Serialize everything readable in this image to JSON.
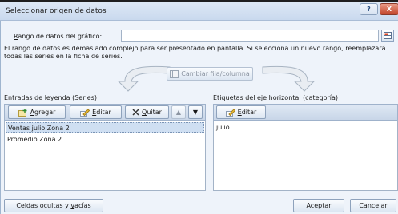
{
  "window": {
    "title": "Seleccionar origen de datos",
    "help_glyph": "?",
    "close_glyph": "X"
  },
  "range": {
    "label_accel": "R",
    "label_rest": "ango de datos del gráfico:",
    "value": ""
  },
  "message": {
    "line1": "El rango de datos es demasiado complejo para ser presentado en pantalla. Si selecciona un nuevo rango, reemplazará",
    "line2": "todas las series en la ficha de series."
  },
  "switch_button": {
    "label_accel": "C",
    "label_rest": "ambiar fila/columna"
  },
  "series_panel": {
    "heading_pre": "Entradas de ley",
    "heading_accel": "e",
    "heading_post": "nda (Series)",
    "add_accel": "A",
    "add_rest": "gregar",
    "edit_accel": "E",
    "edit_rest": "ditar",
    "remove_accel": "Q",
    "remove_rest": "uitar",
    "up_glyph": "▲",
    "down_glyph": "▼",
    "items": [
      "Ventas julio Zona 2",
      "Promedio Zona 2"
    ]
  },
  "category_panel": {
    "heading_pre": "Etiquetas del eje ",
    "heading_accel": "h",
    "heading_post": "orizontal (categoría)",
    "edit_accel": "E",
    "edit_rest": "ditar",
    "items": [
      "julio"
    ]
  },
  "footer": {
    "hidden_cells_pre": "Celdas ocultas y ",
    "hidden_cells_accel": "v",
    "hidden_cells_post": "acías",
    "ok_label": "Aceptar",
    "cancel_label": "Cancelar"
  }
}
